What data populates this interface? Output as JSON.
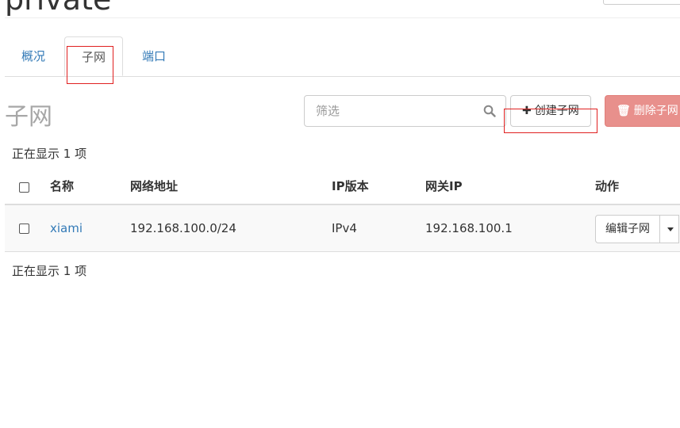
{
  "page": {
    "title": "private"
  },
  "tabs": [
    {
      "label": "概况",
      "active": false
    },
    {
      "label": "子网",
      "active": true
    },
    {
      "label": "端口",
      "active": false
    }
  ],
  "section": {
    "title": "子网"
  },
  "filter": {
    "placeholder": "筛选",
    "value": ""
  },
  "toolbar": {
    "create_label": "创建子网",
    "create_icon": "plus-icon",
    "delete_label": "删除子网",
    "delete_icon": "trash-icon"
  },
  "count_top": "正在显示 1 项",
  "count_bottom": "正在显示 1 项",
  "table": {
    "columns": [
      "名称",
      "网络地址",
      "IP版本",
      "网关IP",
      "动作"
    ],
    "rows": [
      {
        "name": "xiami",
        "network_address": "192.168.100.0/24",
        "ip_version": "IPv4",
        "gateway_ip": "192.168.100.1",
        "action_label": "编辑子网"
      }
    ]
  },
  "colors": {
    "link": "#337ab7",
    "danger": "#e8908c",
    "highlight": "#e02020"
  }
}
